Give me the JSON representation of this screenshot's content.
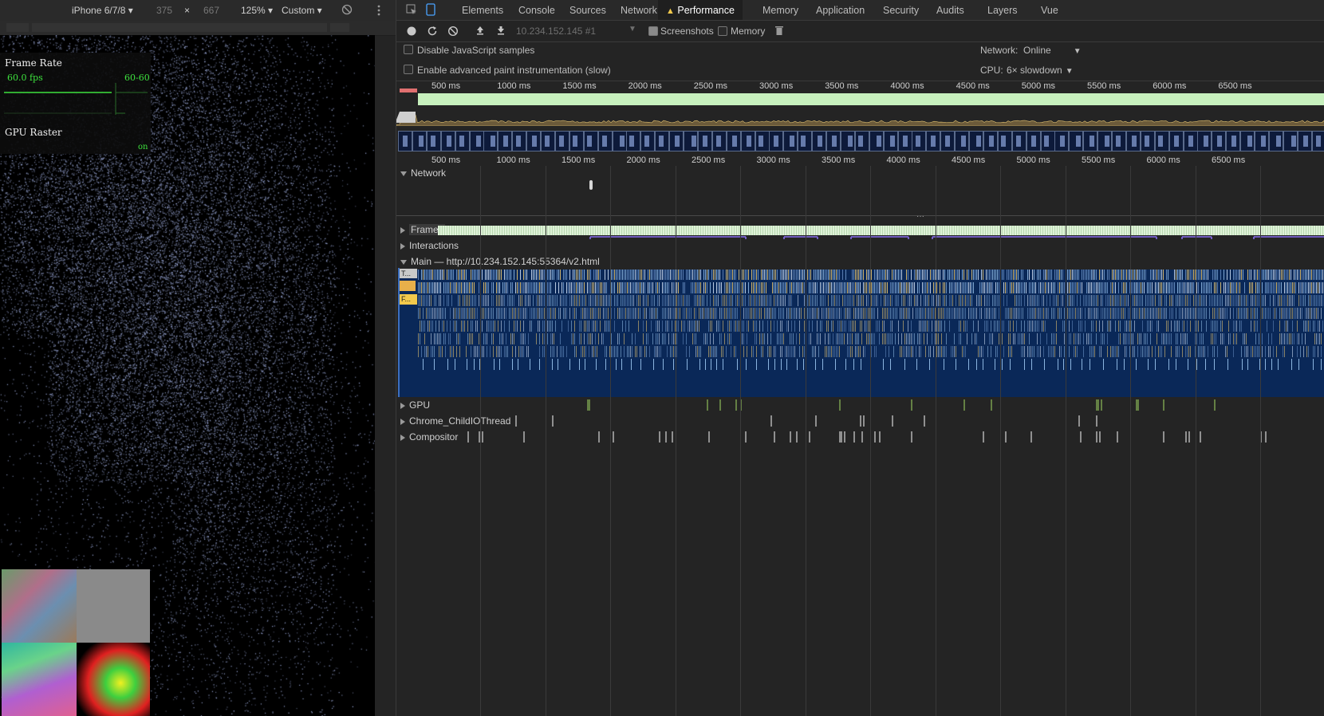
{
  "device_toolbar": {
    "device": "iPhone 6/7/8",
    "width": "375",
    "times": "×",
    "height": "667",
    "zoom": "125%",
    "throttle": "Custom"
  },
  "fps_meter": {
    "title": "Frame Rate",
    "fps": "60.0 fps",
    "range": "60-60",
    "gpu_label": "GPU Raster",
    "gpu_state": "on"
  },
  "devtools": {
    "tabs": [
      "Elements",
      "Console",
      "Sources",
      "Network",
      "Performance",
      "Memory",
      "Application",
      "Security",
      "Audits",
      "Layers",
      "Vue"
    ],
    "active_tab": "Performance",
    "recording": {
      "profile_select": "10.234.152.145 #1",
      "screenshots_label": "Screenshots",
      "screenshots_checked": true,
      "memory_label": "Memory",
      "memory_checked": false
    },
    "settings": {
      "disable_js_samples": "Disable JavaScript samples",
      "advanced_paint": "Enable advanced paint instrumentation (slow)",
      "network_label": "Network:",
      "network_value": "Online",
      "cpu_label": "CPU:",
      "cpu_value": "6× slowdown"
    },
    "timeline_ticks": [
      "500 ms",
      "1000 ms",
      "1500 ms",
      "2000 ms",
      "2500 ms",
      "3000 ms",
      "3500 ms",
      "4000 ms",
      "4500 ms",
      "5000 ms",
      "5500 ms",
      "6000 ms",
      "6500 ms"
    ],
    "tracks": {
      "network": "Network",
      "frames": "Frames",
      "interactions": "Interactions",
      "main": "Main — http://10.234.152.145:55364/v2.html",
      "gpu": "GPU",
      "io_thread": "Chrome_ChildIOThread",
      "compositor": "Compositor"
    },
    "flame_labels": [
      "T...",
      "F..."
    ]
  },
  "colors": {
    "fps_green": "#c7f0bd",
    "flame_bg": "#0a2858",
    "scatter_blue": "#a9b8ec",
    "warning": "#f2c94c"
  }
}
